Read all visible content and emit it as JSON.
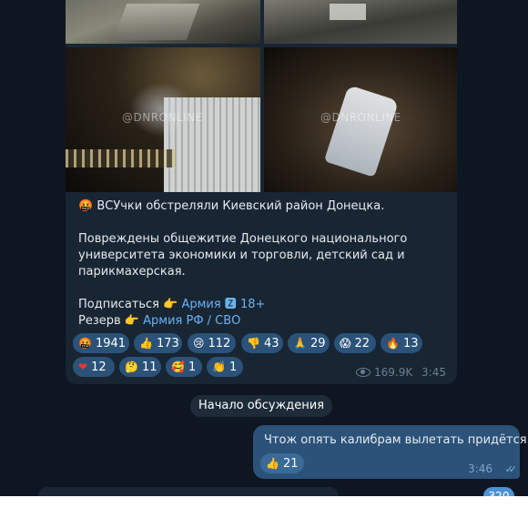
{
  "post": {
    "photos": [
      {
        "watermark": ""
      },
      {
        "watermark": ""
      },
      {
        "watermark": "@DNRONLINE"
      },
      {
        "watermark": "@DNRONLINE"
      }
    ],
    "text": {
      "headline_emoji": "🤬",
      "headline": "ВСУчки обстреляли Киевский район Донецка.",
      "body_line1": "Повреждены общежитие Донецкого национального",
      "body_line2": "университета экономики и торговли, детский сад и",
      "body_line3": "парикмахерская.",
      "subscribe_label": "Подписаться",
      "subscribe_emoji": "👉",
      "subscribe_link": "Армия 🆉 18+",
      "reserve_label": "Резерв",
      "reserve_emoji": "👉",
      "reserve_link": "Армия РФ / СВО"
    },
    "reactions": [
      {
        "icon": "🤬",
        "count": "1941"
      },
      {
        "icon": "👍",
        "count": "173"
      },
      {
        "icon": "😢",
        "count": "112"
      },
      {
        "icon": "👎",
        "count": "43"
      },
      {
        "icon": "🙏",
        "count": "29"
      },
      {
        "icon": "😱",
        "count": "22"
      },
      {
        "icon": "🔥",
        "count": "13"
      },
      {
        "icon": "❤",
        "count": "12"
      },
      {
        "icon": "🤔",
        "count": "11"
      },
      {
        "icon": "🥰",
        "count": "1"
      },
      {
        "icon": "👏",
        "count": "1"
      }
    ],
    "views": "169.9K",
    "time": "3:45"
  },
  "service_message": "Начало обсуждения",
  "reply": {
    "text": "Чтож опять калибрам вылетать придётся...",
    "reaction": {
      "icon": "👍",
      "count": "21"
    },
    "time": "3:46",
    "status_icon": "double-check-icon"
  },
  "unread_count": "320",
  "colors": {
    "background": "#0e1621",
    "bubble_incoming": "#182533",
    "bubble_outgoing": "#2b5278",
    "link": "#6ab3f3",
    "reaction_bg": "#2b5278",
    "badge": "#4c93d5"
  }
}
